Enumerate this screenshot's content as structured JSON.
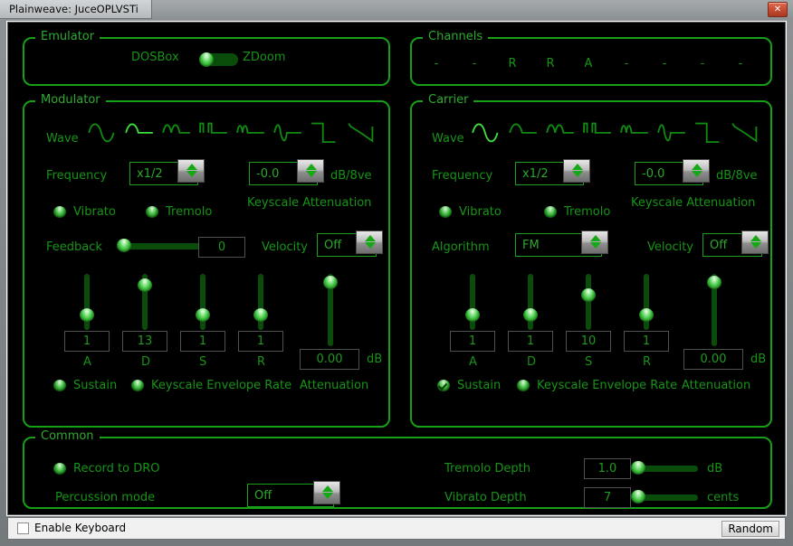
{
  "window": {
    "title": "Plainweave: JuceOPLVSTi",
    "close_label": "✕",
    "close_icon": "close-icon"
  },
  "colors": {
    "accent_green": "#17a417",
    "text_green": "#179417",
    "label_green": "#2faa2f",
    "track_green": "#0a4d0a",
    "canvas_black": "#000000",
    "chrome_grey": "#8e9295",
    "close_red": "#c94f35"
  },
  "emulator": {
    "group_label": "Emulator",
    "left_label": "DOSBox",
    "right_label": "ZDoom",
    "switch_value": "DOSBox",
    "switch_position": 0
  },
  "channels": {
    "group_label": "Channels",
    "slots": [
      "-",
      "-",
      "R",
      "R",
      "A",
      "-",
      "-",
      "-",
      "-"
    ]
  },
  "modulator": {
    "group_label": "Modulator",
    "wave_label": "Wave",
    "waves": [
      "sine",
      "half-sine",
      "abs-sine",
      "pulse-sine",
      "even-sine",
      "even-abs-sine",
      "square",
      "derived-square"
    ],
    "wave_selected": 1,
    "frequency_label": "Frequency",
    "frequency_value": "x1/2",
    "keyscale_value": "-0.0",
    "keyscale_unit": "dB/8ve",
    "keyscale_label": "Keyscale Attenuation",
    "vibrato_label": "Vibrato",
    "vibrato_checked": false,
    "tremolo_label": "Tremolo",
    "tremolo_checked": false,
    "feedback_label": "Feedback",
    "feedback_value": "0",
    "feedback_pct": 0,
    "velocity_label": "Velocity",
    "velocity_value": "Off",
    "envelope": [
      {
        "key": "A",
        "value": "1",
        "pos_pct": 62
      },
      {
        "key": "D",
        "value": "13",
        "pos_pct": 8
      },
      {
        "key": "S",
        "value": "1",
        "pos_pct": 62
      },
      {
        "key": "R",
        "value": "1",
        "pos_pct": 62
      }
    ],
    "attenuation_label": "Attenuation",
    "attenuation_value": "0.00",
    "attenuation_unit": "dB",
    "attenuation_pos_pct": 3,
    "sustain_label": "Sustain",
    "sustain_checked": false,
    "keyscale_env_label": "Keyscale Envelope Rate",
    "keyscale_env_checked": false
  },
  "carrier": {
    "group_label": "Carrier",
    "wave_label": "Wave",
    "waves": [
      "sine",
      "half-sine",
      "abs-sine",
      "pulse-sine",
      "even-sine",
      "even-abs-sine",
      "square",
      "derived-square"
    ],
    "wave_selected": 0,
    "frequency_label": "Frequency",
    "frequency_value": "x1/2",
    "keyscale_value": "-0.0",
    "keyscale_unit": "dB/8ve",
    "keyscale_label": "Keyscale Attenuation",
    "vibrato_label": "Vibrato",
    "vibrato_checked": false,
    "tremolo_label": "Tremolo",
    "tremolo_checked": false,
    "algorithm_label": "Algorithm",
    "algorithm_value": "FM",
    "velocity_label": "Velocity",
    "velocity_value": "Off",
    "envelope": [
      {
        "key": "A",
        "value": "1",
        "pos_pct": 62
      },
      {
        "key": "D",
        "value": "1",
        "pos_pct": 62
      },
      {
        "key": "S",
        "value": "10",
        "pos_pct": 26
      },
      {
        "key": "R",
        "value": "1",
        "pos_pct": 62
      }
    ],
    "attenuation_label": "Attenuation",
    "attenuation_value": "0.00",
    "attenuation_unit": "dB",
    "attenuation_pos_pct": 3,
    "sustain_label": "Sustain",
    "sustain_checked": true,
    "keyscale_env_label": "Keyscale Envelope Rate",
    "keyscale_env_checked": false
  },
  "common": {
    "group_label": "Common",
    "record_label": "Record to DRO",
    "record_checked": false,
    "percussion_label": "Percussion mode",
    "percussion_value": "Off",
    "tremolo_depth_label": "Tremolo Depth",
    "tremolo_depth_value": "1.0",
    "tremolo_depth_unit": "dB",
    "tremolo_depth_pct": 0,
    "vibrato_depth_label": "Vibrato Depth",
    "vibrato_depth_value": "7",
    "vibrato_depth_unit": "cents",
    "vibrato_depth_pct": 0
  },
  "bottom": {
    "enable_keyboard_label": "Enable Keyboard",
    "enable_keyboard_checked": false,
    "random_label": "Random"
  }
}
